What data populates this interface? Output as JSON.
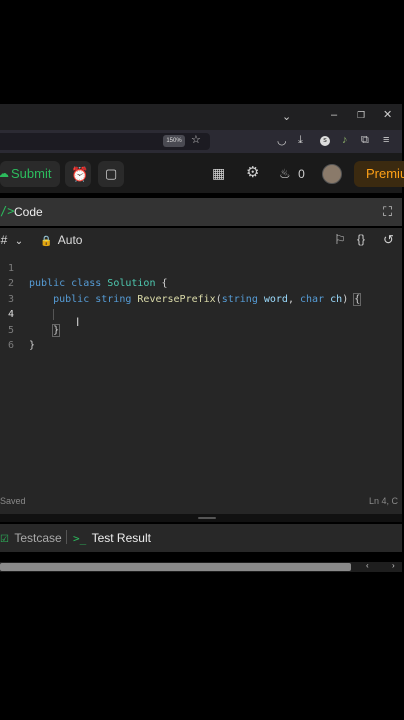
{
  "browser": {
    "zoom_level": "150%"
  },
  "header": {
    "submit_label": "Submit",
    "streak_count": "0",
    "premium_label": "Premiu"
  },
  "code_panel": {
    "tab_label": "Code",
    "language": "C#",
    "autocomplete_label": "Auto"
  },
  "editor": {
    "line_numbers": [
      "1",
      "2",
      "3",
      "4",
      "5",
      "6"
    ]
  },
  "status": {
    "saved_label": "Saved",
    "cursor_position": "Ln 4, C"
  },
  "test_tabs": {
    "testcase_label": "Testcase",
    "test_result_label": "Test Result"
  },
  "colors": {
    "accent_green": "#2cbb5d",
    "premium_orange": "#ffa116"
  }
}
